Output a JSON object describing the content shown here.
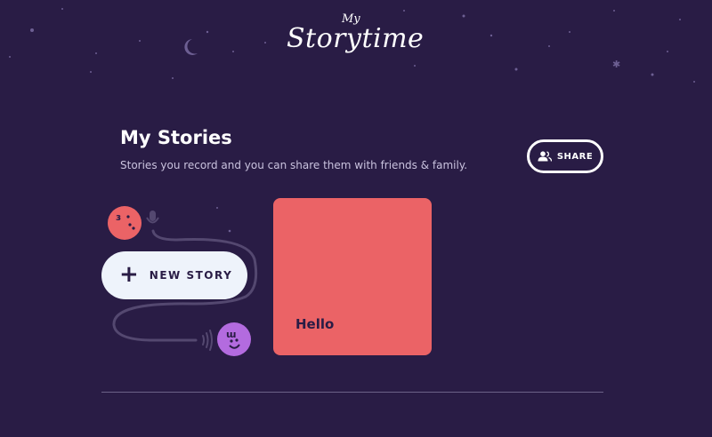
{
  "header": {
    "logo_small": "My",
    "logo_main": "Storytime"
  },
  "main": {
    "title": "My Stories",
    "subtitle": "Stories you record and you can share them with friends & family.",
    "share_label": "SHARE",
    "new_story_label": "NEW STORY",
    "stories": [
      {
        "title": "Hello",
        "color": "#eb6366"
      }
    ]
  },
  "icons": {
    "share": "people-icon",
    "new_story": "plus-icon",
    "moon": "crescent-moon-icon",
    "microphone": "microphone-icon",
    "sound": "sound-waves-icon"
  },
  "colors": {
    "background": "#291c45",
    "accent_red": "#eb6366",
    "accent_purple": "#b36bdf",
    "button_light": "#eef3fb",
    "text_muted": "#c9c2de"
  }
}
